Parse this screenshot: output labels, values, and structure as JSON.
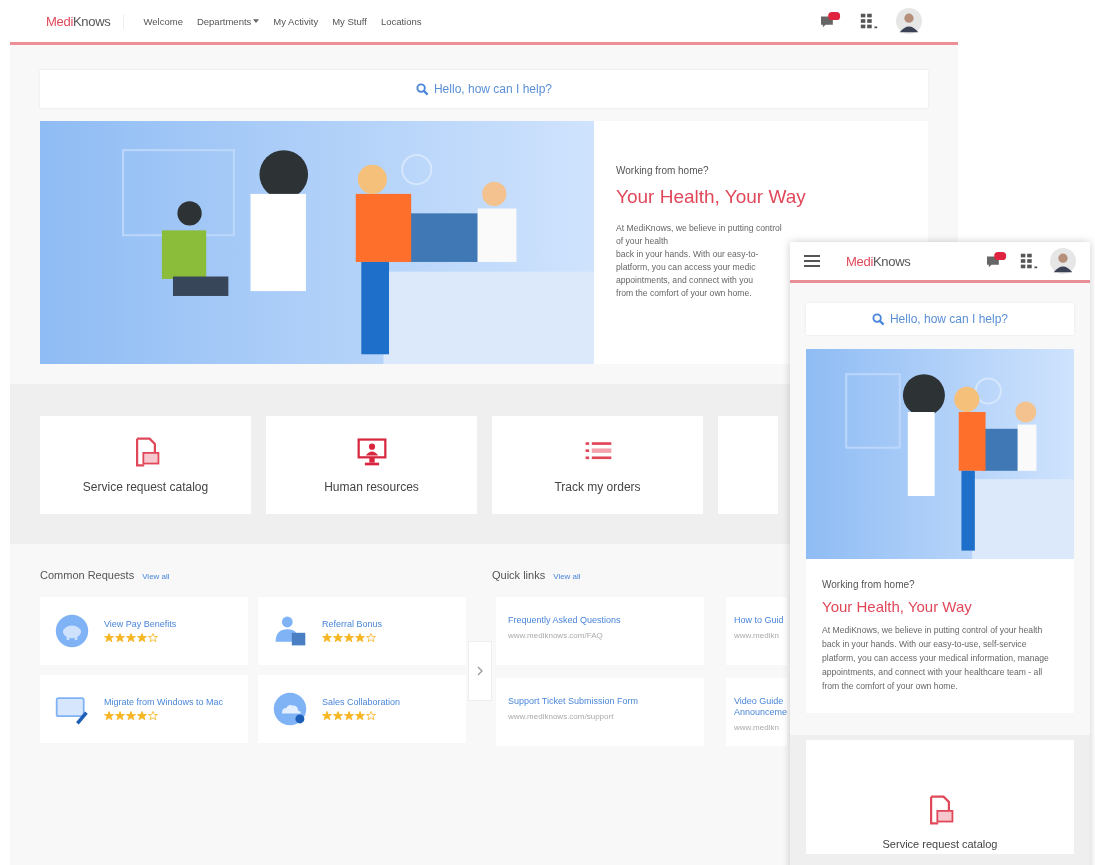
{
  "desktop": {
    "logo": {
      "accent": "Medi",
      "rest": "Knows"
    },
    "nav": [
      {
        "label": "Welcome",
        "dropdown": false
      },
      {
        "label": "Departments",
        "dropdown": true
      },
      {
        "label": "My Activity",
        "dropdown": false
      },
      {
        "label": "My Stuff",
        "dropdown": false
      },
      {
        "label": "Locations",
        "dropdown": false
      }
    ],
    "search": {
      "placeholder": "Hello, how can I help?"
    },
    "hero": {
      "eyebrow": "Working from home?",
      "title": "Your Health, Your Way",
      "lines": [
        "At MediKnows, we believe in putting control of your health",
        "back in your hands. With our easy-to-",
        "platform, you can access your medic",
        "appointments, and connect with you",
        "from the comfort of your own home."
      ]
    },
    "categories": [
      {
        "label": "Service request catalog",
        "kind": "document"
      },
      {
        "label": "Human resources",
        "kind": "monitor"
      },
      {
        "label": "Track my orders",
        "kind": "list"
      }
    ],
    "common_requests": {
      "title": "Common Requests",
      "link": "View all",
      "items": [
        {
          "title": "View Pay Benefits",
          "kind": "piggy",
          "stars": 4
        },
        {
          "title": "Referral Bonus",
          "kind": "person",
          "stars": 4
        },
        {
          "title": "Migrate from Windows to Mac",
          "kind": "screen",
          "stars": 4
        },
        {
          "title": "Sales Collaboration",
          "kind": "cloud",
          "stars": 4
        }
      ]
    },
    "quick_links": {
      "title": "Quick links",
      "link": "View all",
      "items": [
        {
          "title": "Frequently Asked Questions",
          "url": "www.mediknows.com/FAQ"
        },
        {
          "title": "How to Guid",
          "url": "www.medikn"
        },
        {
          "title": "Support Ticket Submission Form",
          "url": "www.mediknows.com/support"
        },
        {
          "title": "Video Guide",
          "title2": "Announceme",
          "url": "www.medikn"
        }
      ]
    }
  },
  "mobile": {
    "logo": {
      "accent": "Medi",
      "rest": "Knows"
    },
    "search": {
      "placeholder": "Hello, how can I help?"
    },
    "hero": {
      "eyebrow": "Working from home?",
      "title": "Your Health, Your Way",
      "text": "At MediKnows, we believe in putting control of your health back in your hands. With our easy-to-use, self-service platform, you can access your medical information, manage appointments, and connect with your healthcare team - all from the comfort of your own home."
    },
    "category": {
      "label": "Service request catalog",
      "kind": "document"
    }
  }
}
